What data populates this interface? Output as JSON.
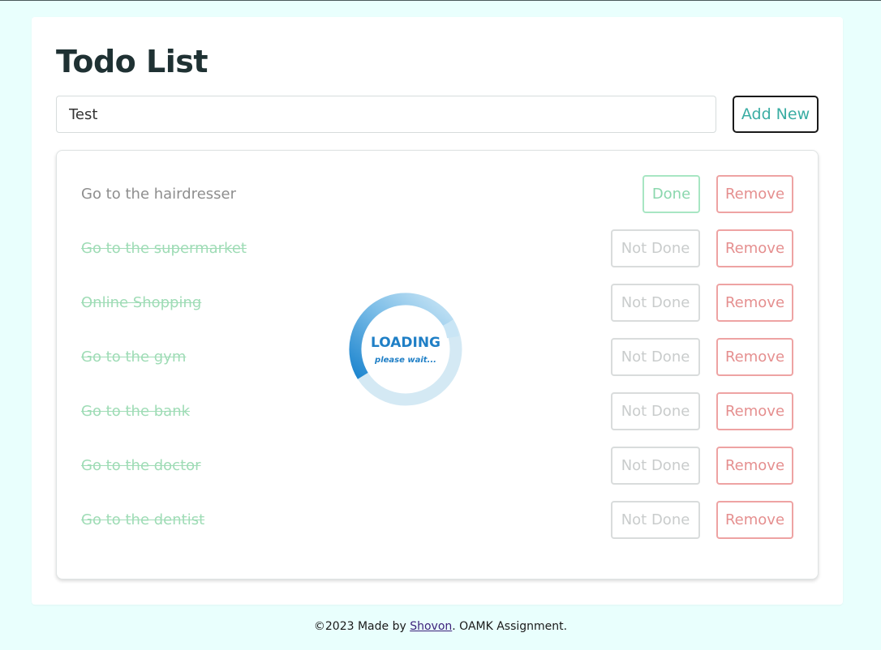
{
  "header": {
    "title": "Todo List"
  },
  "new_todo": {
    "value": "Test",
    "add_label": "Add New"
  },
  "todos": [
    {
      "text": "Go to the hairdresser",
      "completed": false,
      "toggle_label": "Done",
      "remove_label": "Remove"
    },
    {
      "text": "Go to the supermarket",
      "completed": true,
      "toggle_label": "Not Done",
      "remove_label": "Remove"
    },
    {
      "text": "Online Shopping",
      "completed": true,
      "toggle_label": "Not Done",
      "remove_label": "Remove"
    },
    {
      "text": "Go to the gym",
      "completed": true,
      "toggle_label": "Not Done",
      "remove_label": "Remove"
    },
    {
      "text": "Go to the bank",
      "completed": true,
      "toggle_label": "Not Done",
      "remove_label": "Remove"
    },
    {
      "text": "Go to the doctor",
      "completed": true,
      "toggle_label": "Not Done",
      "remove_label": "Remove"
    },
    {
      "text": "Go to the dentist",
      "completed": true,
      "toggle_label": "Not Done",
      "remove_label": "Remove"
    }
  ],
  "loader": {
    "main": "LOADING",
    "sub": "please wait..."
  },
  "footer": {
    "prefix": "©2023 Made by ",
    "author_link": "Shovon",
    "suffix": ". OAMK Assignment."
  },
  "colors": {
    "background": "#e9fffd",
    "accent": "#3aada3",
    "done_text": "#9fdcb6",
    "remove": "#e58f8f",
    "loader_blue": "#1f7fc6"
  }
}
